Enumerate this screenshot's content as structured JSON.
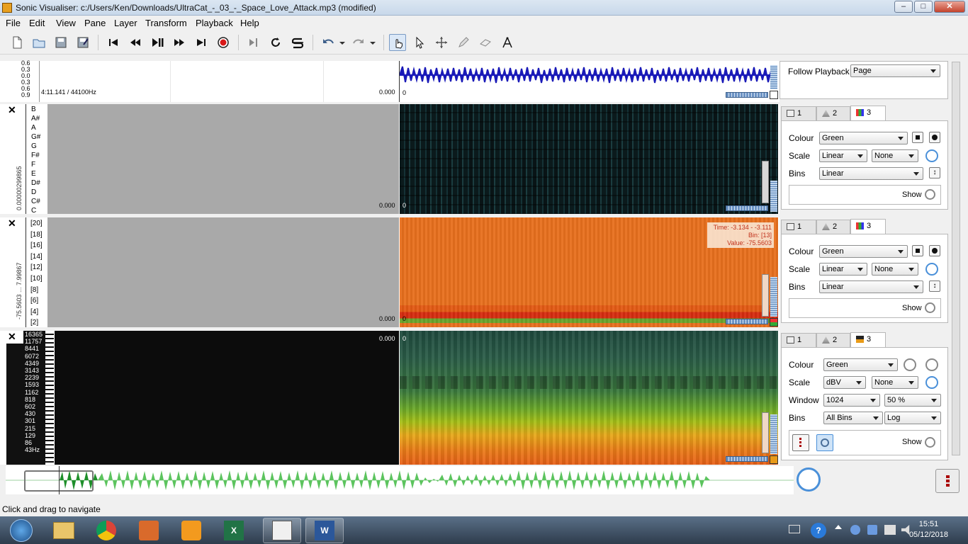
{
  "window": {
    "title": "Sonic Visualiser: c:/Users/Ken/Downloads/UltraCat_-_03_-_Space_Love_Attack.mp3 (modified)",
    "min": "–",
    "max": "□",
    "close": "✕"
  },
  "menu": [
    "File",
    "Edit",
    "View",
    "Pane",
    "Layer",
    "Transform",
    "Playback",
    "Help"
  ],
  "waveform_pane": {
    "scale_labels": [
      "0.6",
      "0.3",
      "0.0",
      "0.3",
      "0.6",
      "0.9",
      "0.9"
    ],
    "time_info": "4:11.141 / 44100Hz",
    "left_time": "0.000",
    "right_time": "0",
    "follow_label": "Follow Playback",
    "follow_value": "Page"
  },
  "chroma_pane": {
    "close": "✕",
    "vertical_label": "0.00000299865",
    "notes": [
      "B",
      "A#",
      "A",
      "G#",
      "G",
      "F#",
      "F",
      "E",
      "D#",
      "D",
      "C#",
      "C"
    ],
    "left_time": "0.000",
    "right_time": "0",
    "tabs": [
      "1",
      "2",
      "3"
    ],
    "colour_label": "Colour",
    "colour_value": "Green",
    "scale_label": "Scale",
    "scale_value": "Linear",
    "scale_norm": "None",
    "bins_label": "Bins",
    "bins_value": "Linear",
    "show_label": "Show"
  },
  "bins_pane": {
    "close": "✕",
    "vertical_label": "-75.5603 ... 7.99867",
    "bins": [
      "[20]",
      "[18]",
      "[16]",
      "[14]",
      "[12]",
      "[10]",
      "[8]",
      "[6]",
      "[4]",
      "[2]"
    ],
    "left_time": "0.000",
    "right_time": "0",
    "tooltip": {
      "time": "Time: -3.134 - -3.111",
      "bin": "Bin: [13]",
      "value": "Value: -75.5603"
    },
    "tabs": [
      "1",
      "2",
      "3"
    ],
    "colour_label": "Colour",
    "colour_value": "Green",
    "scale_label": "Scale",
    "scale_value": "Linear",
    "scale_norm": "None",
    "bins_label": "Bins",
    "bins_value": "Linear",
    "show_label": "Show"
  },
  "spectrogram_pane": {
    "close": "✕",
    "freqs": [
      "16365",
      "11757",
      "8441",
      "6072",
      "4349",
      "3143",
      "2239",
      "1593",
      "1162",
      "818",
      "602",
      "430",
      "301",
      "215",
      "129",
      "86",
      "43Hz"
    ],
    "left_time": "0.000",
    "right_time": "0",
    "tabs": [
      "1",
      "2",
      "3"
    ],
    "colour_label": "Colour",
    "colour_value": "Green",
    "scale_label": "Scale",
    "scale_value": "dBV",
    "scale_norm": "None",
    "window_label": "Window",
    "window_value": "1024",
    "overlap_value": "50 %",
    "bins_label": "Bins",
    "bins_value": "All Bins",
    "bins_scale": "Log",
    "show_label": "Show"
  },
  "status": "Click and drag to navigate",
  "taskbar": {
    "time": "15:51",
    "date": "05/12/2018"
  },
  "colors": {
    "waveform": "#1a1ab8",
    "chroma_bg": "#0b1a1c",
    "bins_bg": "#e8701e",
    "overview": "#3fb24a",
    "accent": "#4a90d9"
  }
}
